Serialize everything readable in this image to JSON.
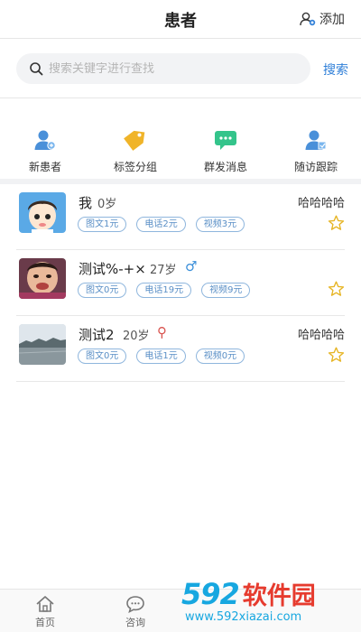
{
  "header": {
    "title": "患者",
    "add_label": "添加"
  },
  "search": {
    "placeholder": "搜索关键字进行查找",
    "button_label": "搜索"
  },
  "quick_actions": [
    {
      "label": "新患者",
      "icon": "new-patient-icon"
    },
    {
      "label": "标签分组",
      "icon": "tag-group-icon"
    },
    {
      "label": "群发消息",
      "icon": "mass-message-icon"
    },
    {
      "label": "随访跟踪",
      "icon": "follow-up-icon"
    }
  ],
  "patients": [
    {
      "name": "我",
      "age": "0岁",
      "gender": "",
      "note": "哈哈哈哈",
      "tags": [
        "图文1元",
        "电话2元",
        "视频3元"
      ]
    },
    {
      "name": "测试%-+×",
      "age": "27岁",
      "gender": "male",
      "note": "",
      "tags": [
        "图文0元",
        "电话19元",
        "视频9元"
      ]
    },
    {
      "name": "测试2",
      "age": "20岁",
      "gender": "female",
      "note": "哈哈哈哈",
      "tags": [
        "图文0元",
        "电话1元",
        "视频0元"
      ]
    }
  ],
  "tabbar": [
    {
      "label": "首页",
      "icon": "home-icon"
    },
    {
      "label": "咨询",
      "icon": "chat-icon"
    }
  ],
  "watermark": {
    "brand_num": "592",
    "brand_cn": "软件园",
    "url": "www.592xiazai.com"
  },
  "colors": {
    "accent": "#2f7fd8",
    "tag_border": "#8fb6dd",
    "star": "#e6b422",
    "male": "#3b8fd9",
    "female": "#d9534f"
  }
}
